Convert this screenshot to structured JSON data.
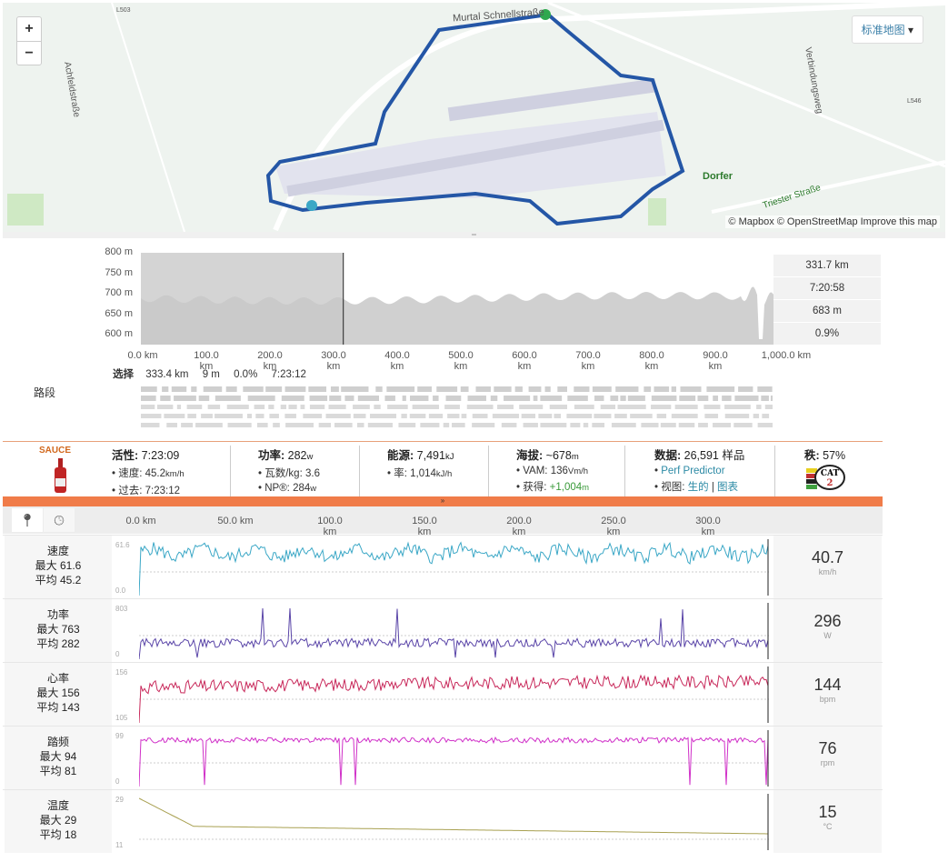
{
  "map": {
    "zoom_in": "+",
    "zoom_out": "−",
    "map_type": "标准地图",
    "labels": [
      "Murtal Schnellstraße",
      "Achfeldstraße",
      "Verbindungsweg",
      "Dorfer",
      "Triester Straße",
      "L503",
      "L546"
    ],
    "attribution": "© Mapbox © OpenStreetMap Improve this map",
    "route_color": "#2456a6",
    "start_color": "#2fa84f",
    "end_color": "#3aa7c6"
  },
  "elevation": {
    "y_ticks": [
      "800 m",
      "750 m",
      "700 m",
      "650 m",
      "600 m"
    ],
    "x_ticks": [
      "0.0 km",
      "100.0 km",
      "200.0 km",
      "300.0 km",
      "400.0 km",
      "500.0 km",
      "600.0 km",
      "700.0 km",
      "800.0 km",
      "900.0 km",
      "1,000.0 km"
    ],
    "panel": [
      "331.7 km",
      "7:20:58",
      "683 m",
      "0.9%"
    ],
    "selection": {
      "label": "选择",
      "distance": "333.4 km",
      "elev": "9 m",
      "grade": "0.0%",
      "time": "7:23:12"
    },
    "segments_label": "路段",
    "selected_fraction": 0.32
  },
  "stats": {
    "logo": "SAUCE",
    "active": {
      "label": "活性:",
      "value": "7:23:09",
      "speed_label": "速度:",
      "speed": "45.2",
      "speed_unit": "km/h",
      "elapsed_label": "过去:",
      "elapsed": "7:23:12"
    },
    "power": {
      "label": "功率:",
      "value": "282",
      "unit": "w",
      "wkg_label": "瓦数/kg:",
      "wkg": "3.6",
      "np_label": "NP®:",
      "np": "284",
      "np_unit": "w"
    },
    "energy": {
      "label": "能源:",
      "value": "7,491",
      "unit": "kJ",
      "rate_label": "率:",
      "rate": "1,014",
      "rate_unit": "kJ/h"
    },
    "elev": {
      "label": "海拔:",
      "value": "~678",
      "unit": "m",
      "vam_label": "VAM:",
      "vam": "136",
      "vam_unit": "Vm/h",
      "gain_label": "获得:",
      "gain": "+1,004",
      "gain_unit": "m"
    },
    "data": {
      "label": "数据:",
      "value": "26,591 样品",
      "perf": "Perf Predictor",
      "view_label": "视图:",
      "raw": "生的",
      "sep": "|",
      "chart": "图表"
    },
    "grade": {
      "label": "秩:",
      "value": "57%",
      "badge": "CAT 2"
    }
  },
  "streams": {
    "x_ticks": [
      "0.0 km",
      "50.0 km",
      "100.0 km",
      "150.0 km",
      "200.0 km",
      "250.0 km",
      "300.0 km"
    ]
  },
  "chart_data": [
    {
      "type": "line",
      "name": "速度",
      "max_label": "最大 61.6",
      "avg_label": "平均 45.2",
      "ymax": "61.6",
      "ymin": "0.0",
      "current": "40.7",
      "unit": "km/h",
      "color": "#3aa7c6",
      "base": 0.78,
      "noise": 0.12
    },
    {
      "type": "line",
      "name": "功率",
      "max_label": "最大 763",
      "avg_label": "平均 282",
      "ymax": "803",
      "ymin": "0",
      "current": "296",
      "unit": "W",
      "color": "#5a45a8",
      "base": 0.3,
      "noise": 0.08
    },
    {
      "type": "line",
      "name": "心率",
      "max_label": "最大 156",
      "avg_label": "平均 143",
      "ymax": "156",
      "ymin": "105",
      "current": "144",
      "unit": "bpm",
      "color": "#c8285a",
      "base": 0.65,
      "noise": 0.12
    },
    {
      "type": "line",
      "name": "踏频",
      "max_label": "最大 94",
      "avg_label": "平均 81",
      "ymax": "99",
      "ymin": "0",
      "current": "76",
      "unit": "rpm",
      "color": "#d030c8",
      "base": 0.85,
      "noise": 0.05
    },
    {
      "type": "line",
      "name": "温度",
      "max_label": "最大 29",
      "avg_label": "平均 18",
      "ymax": "29",
      "ymin": "11",
      "current": "15",
      "unit": "°C",
      "color": "#a8a050",
      "base": 0.4,
      "noise": 0
    }
  ]
}
